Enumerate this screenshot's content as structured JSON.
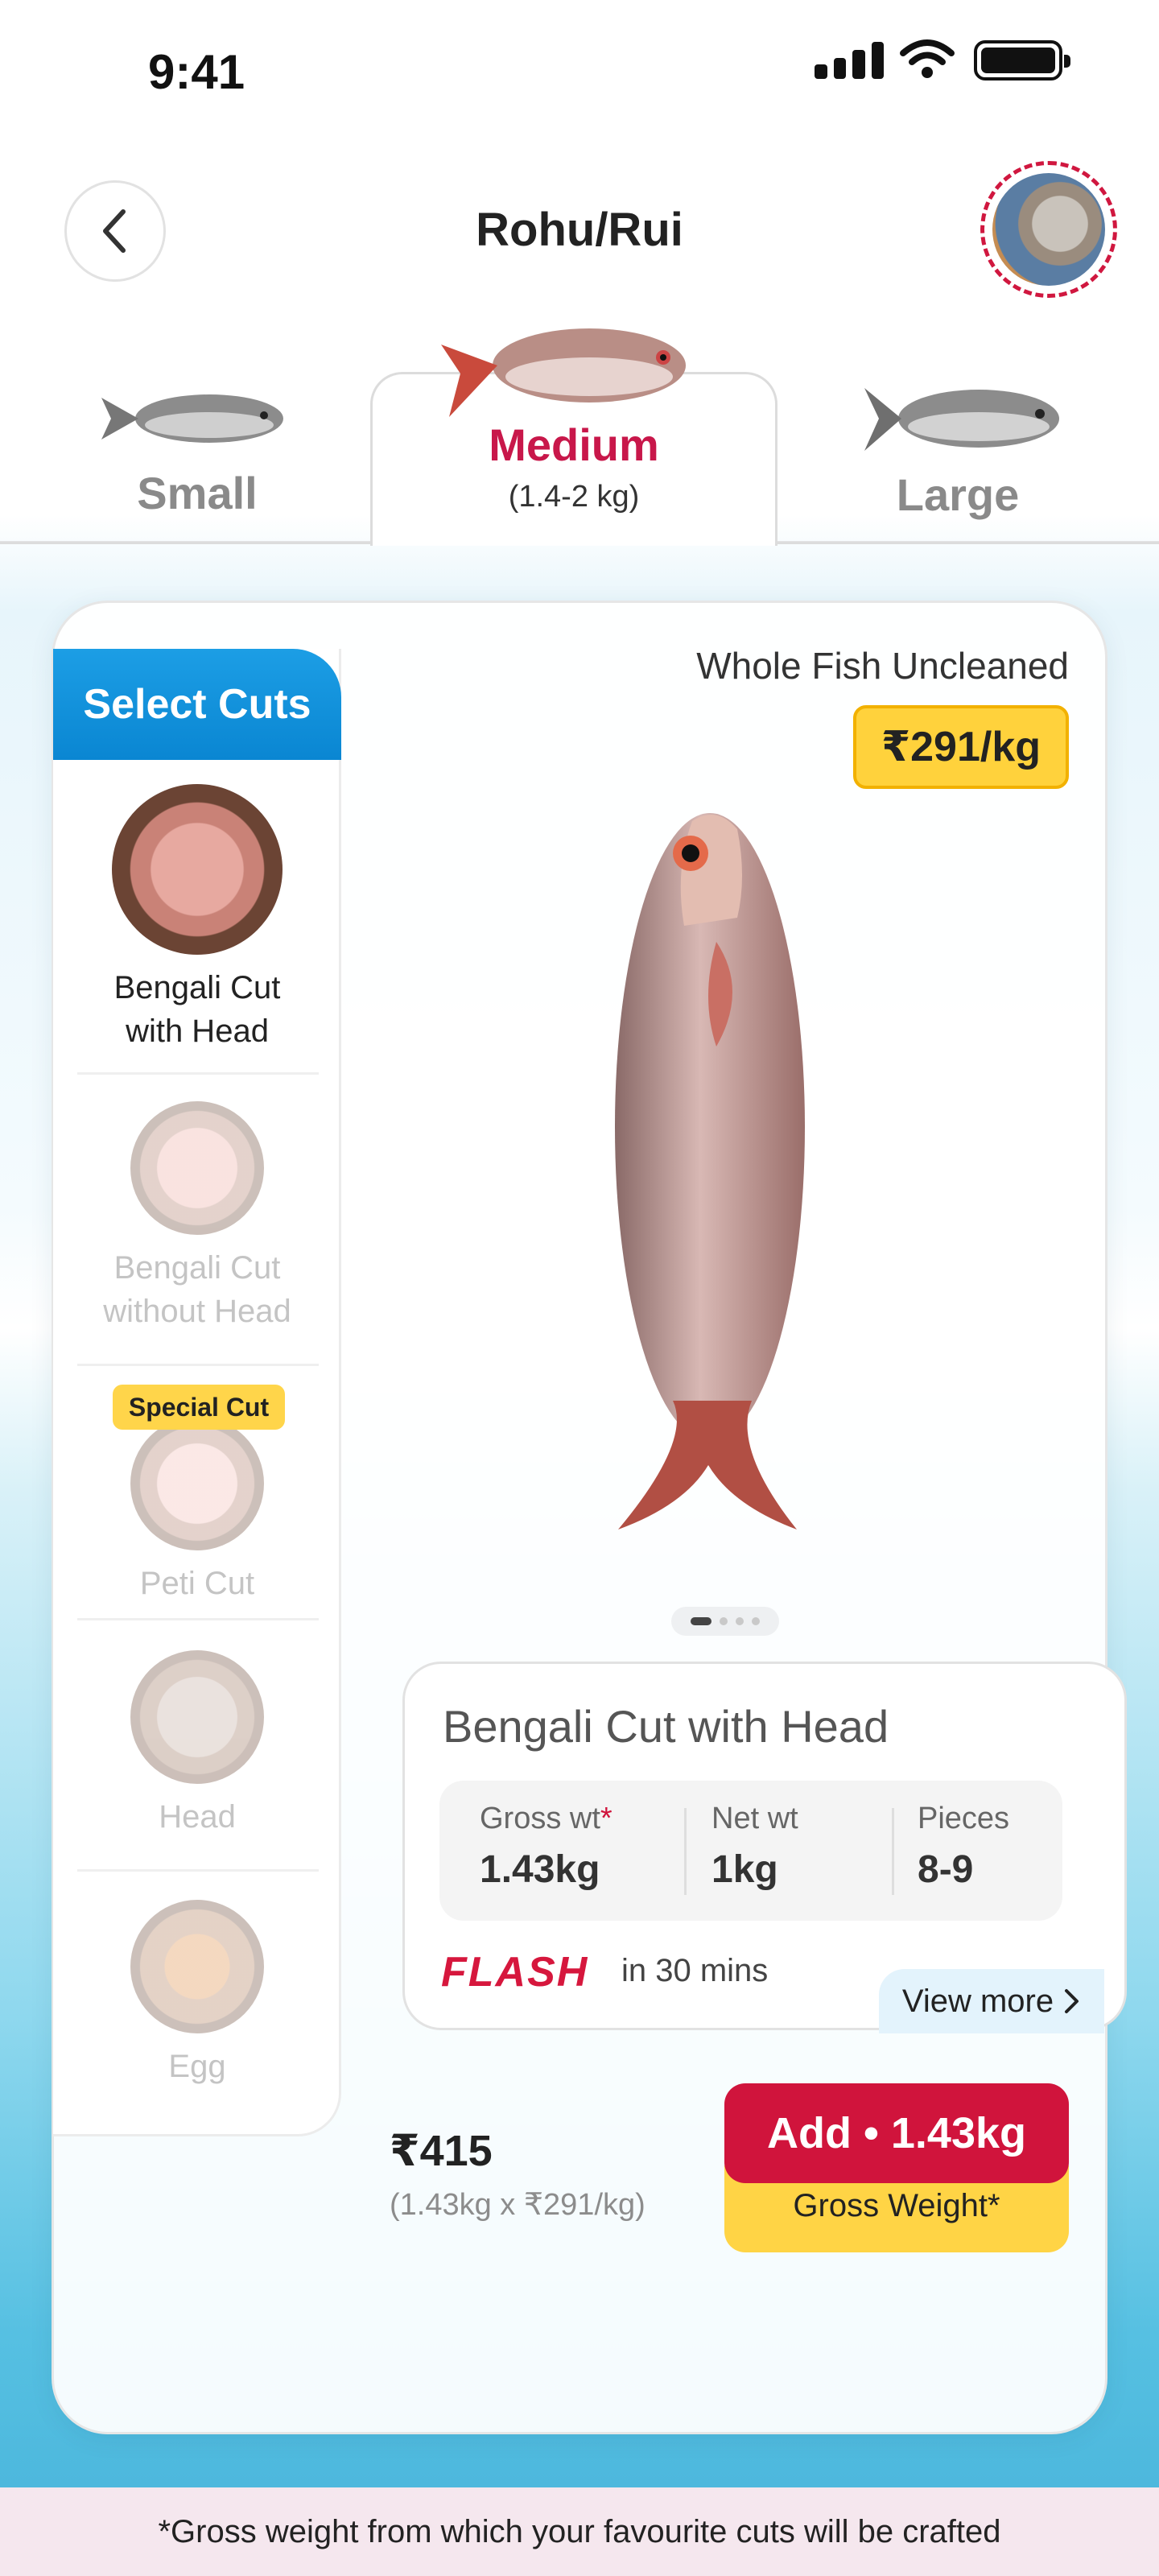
{
  "status_bar": {
    "time": "9:41"
  },
  "header": {
    "title": "Rohu/Rui"
  },
  "size_tabs": [
    {
      "label": "Small",
      "sub": ""
    },
    {
      "label": "Medium",
      "sub": "(1.4-2 kg)"
    },
    {
      "label": "Large",
      "sub": ""
    }
  ],
  "selected_size": "Medium",
  "cuts_panel": {
    "header": "Select Cuts",
    "special_badge": "Special Cut",
    "items": [
      {
        "label_1": "Bengali Cut",
        "label_2": "with Head",
        "selected": true
      },
      {
        "label_1": "Bengali Cut",
        "label_2": "without Head",
        "selected": false
      },
      {
        "label_1": "Peti Cut",
        "label_2": "",
        "selected": false,
        "special": true
      },
      {
        "label_1": "Head",
        "label_2": "",
        "selected": false
      },
      {
        "label_1": "Egg",
        "label_2": "",
        "selected": false
      }
    ]
  },
  "product": {
    "name": "Whole Fish Uncleaned",
    "price": "₹291/kg",
    "carousel_pages": 4,
    "carousel_active": 1
  },
  "cut_details": {
    "title": "Bengali Cut with Head",
    "gross_label": "Gross wt",
    "gross_star": "*",
    "gross_value": "1.43kg",
    "net_label": "Net wt",
    "net_value": "1kg",
    "pieces_label": "Pieces",
    "pieces_value": "8-9",
    "delivery_brand": "FLASH",
    "delivery_eta": "in 30 mins",
    "view_more": "View more"
  },
  "pricing": {
    "total": "₹415",
    "calc": "(1.43kg x ₹291/kg)",
    "add_button": "Add • 1.43kg",
    "gross_note": "Gross Weight*"
  },
  "footer": {
    "note": "*Gross weight from which your favourite cuts will be crafted"
  },
  "colors": {
    "accent": "#d0143c",
    "blue": "#0a86d2",
    "yellow": "#ffd23c"
  }
}
